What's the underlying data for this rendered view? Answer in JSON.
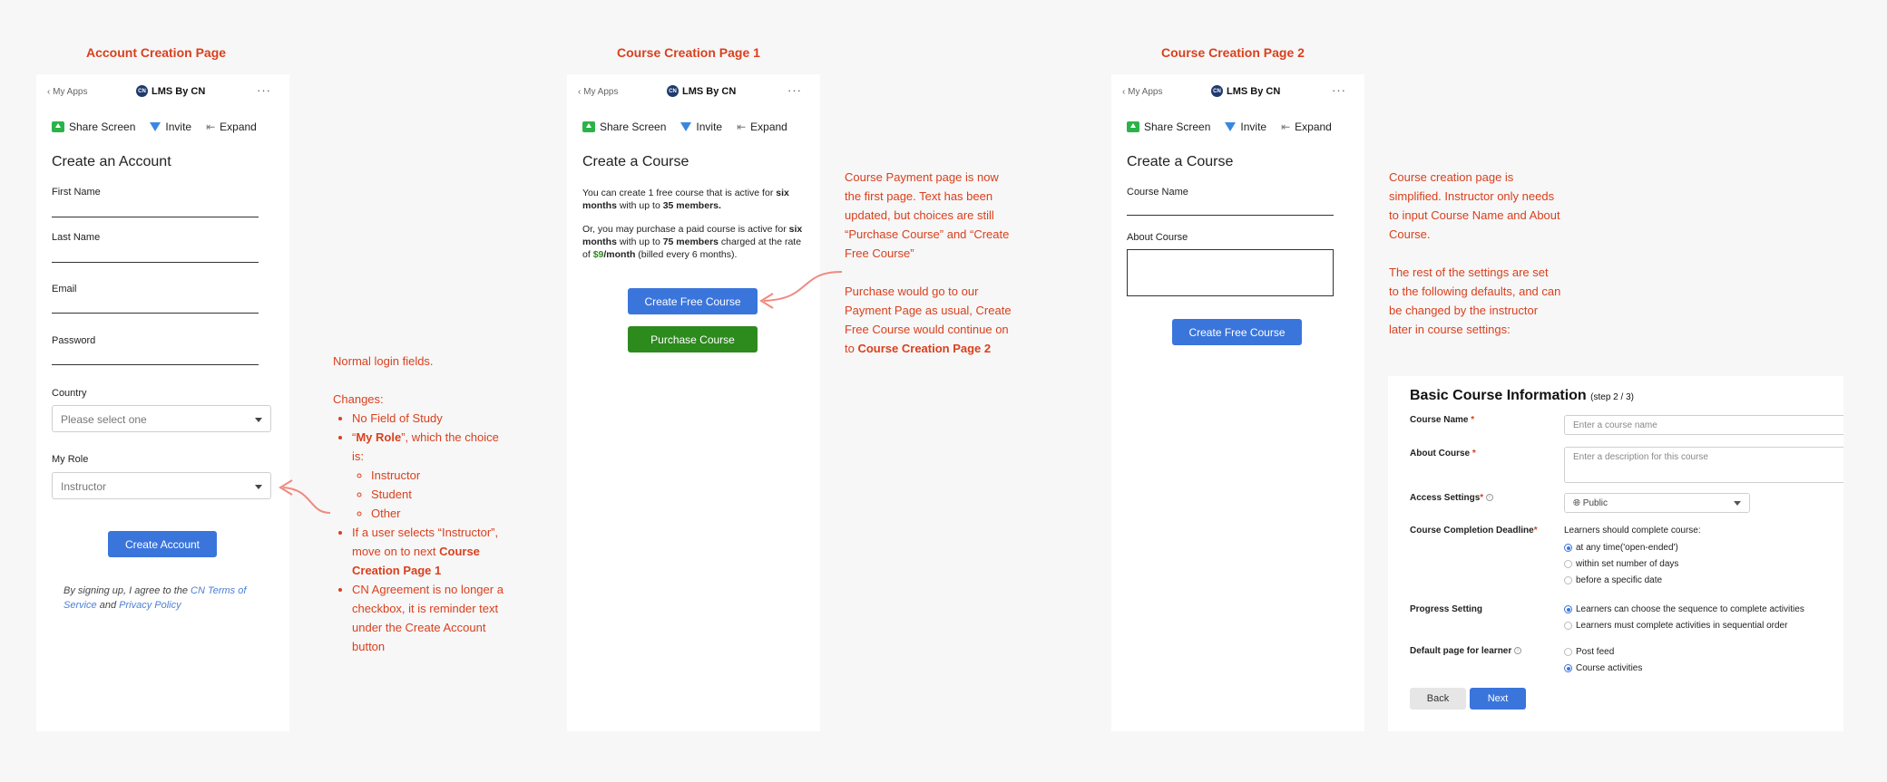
{
  "sections": {
    "account": "Account Creation Page",
    "course1": "Course Creation Page 1",
    "course2": "Course Creation Page 2"
  },
  "app": {
    "back": "My Apps",
    "logo": "CN",
    "brand": "LMS By CN",
    "more": "···",
    "share": "Share Screen",
    "invite": "Invite",
    "expand": "Expand"
  },
  "account_page": {
    "title": "Create an Account",
    "first_name": "First Name",
    "last_name": "Last Name",
    "email": "Email",
    "password": "Password",
    "country_label": "Country",
    "country_value": "Please select one",
    "role_label": "My Role",
    "role_value": "Instructor",
    "create_button": "Create Account",
    "agree_prefix": "By signing up, I agree to the ",
    "terms_link": "CN Terms of Service",
    "agree_and": " and ",
    "privacy_link": "Privacy Policy"
  },
  "course_page1": {
    "title": "Create a Course",
    "p1_a": "You can create 1 free course that is active for ",
    "p1_b": "six months",
    "p1_c": " with up to ",
    "p1_d": "35 members.",
    "p2_a": "Or, you may purchase a paid course is active for ",
    "p2_b": "six months",
    "p2_c": " with up to ",
    "p2_d": "75 members",
    "p2_e": " charged at the rate of ",
    "p2_f": "$9",
    "p2_g": "/month",
    "p2_h": " (billed every 6 months).",
    "free_button": "Create Free Course",
    "purchase_button": "Purchase Course"
  },
  "course_page2": {
    "title": "Create a Course",
    "course_name": "Course Name",
    "about_course": "About Course",
    "free_button": "Create Free Course"
  },
  "notes": {
    "login_intro": "Normal login fields.",
    "changes": "Changes:",
    "c1": "No Field of Study",
    "c2_a": "“",
    "c2_b": "My Role",
    "c2_c": "”, which the choice is:",
    "role1": "Instructor",
    "role2": "Student",
    "role3": "Other",
    "c3_a": "If a user selects “Instructor”, move on to next ",
    "c3_b": "Course Creation Page 1",
    "c4": "CN Agreement is no longer a checkbox, it is reminder text under the Create Account button",
    "payment_1": "Course Payment page is now the first page. Text has been updated, but choices are still “Purchase Course” and “Create Free Course”",
    "payment_2_a": "Purchase would go to our Payment Page as usual, Create Free Course would continue on to ",
    "payment_2_b": "Course Creation Page 2",
    "simplified": "Course creation page is simplified. Instructor only needs to input Course Name and About Course.",
    "defaults": "The rest of the settings are set to the following defaults, and can be changed by the instructor later in course settings:"
  },
  "settings": {
    "title": "Basic Course Information",
    "step": "(step 2 / 3)",
    "course_name_label": "Course Name",
    "course_name_placeholder": "Enter a course name",
    "about_label": "About Course",
    "about_placeholder": "Enter a description for this course",
    "access_label": "Access Settings",
    "access_value": "Public",
    "deadline_label": "Course Completion Deadline",
    "deadline_text": "Learners should complete course:",
    "deadline_opt1": "at any time('open-ended')",
    "deadline_opt2": "within set number of days",
    "deadline_opt3": "before a specific date",
    "progress_label": "Progress Setting",
    "progress_opt1": "Learners can choose the sequence to complete activities",
    "progress_opt2": "Learners must complete activities in sequential order",
    "default_label": "Default page for learner",
    "default_opt1": "Post feed",
    "default_opt2": "Course activities",
    "back_button": "Back",
    "next_button": "Next",
    "required_mark": "*"
  },
  "colors": {
    "annotation": "#d9401e",
    "primary": "#3a75db",
    "purchase": "#2d8a1d",
    "arrow": "#f08a80"
  }
}
